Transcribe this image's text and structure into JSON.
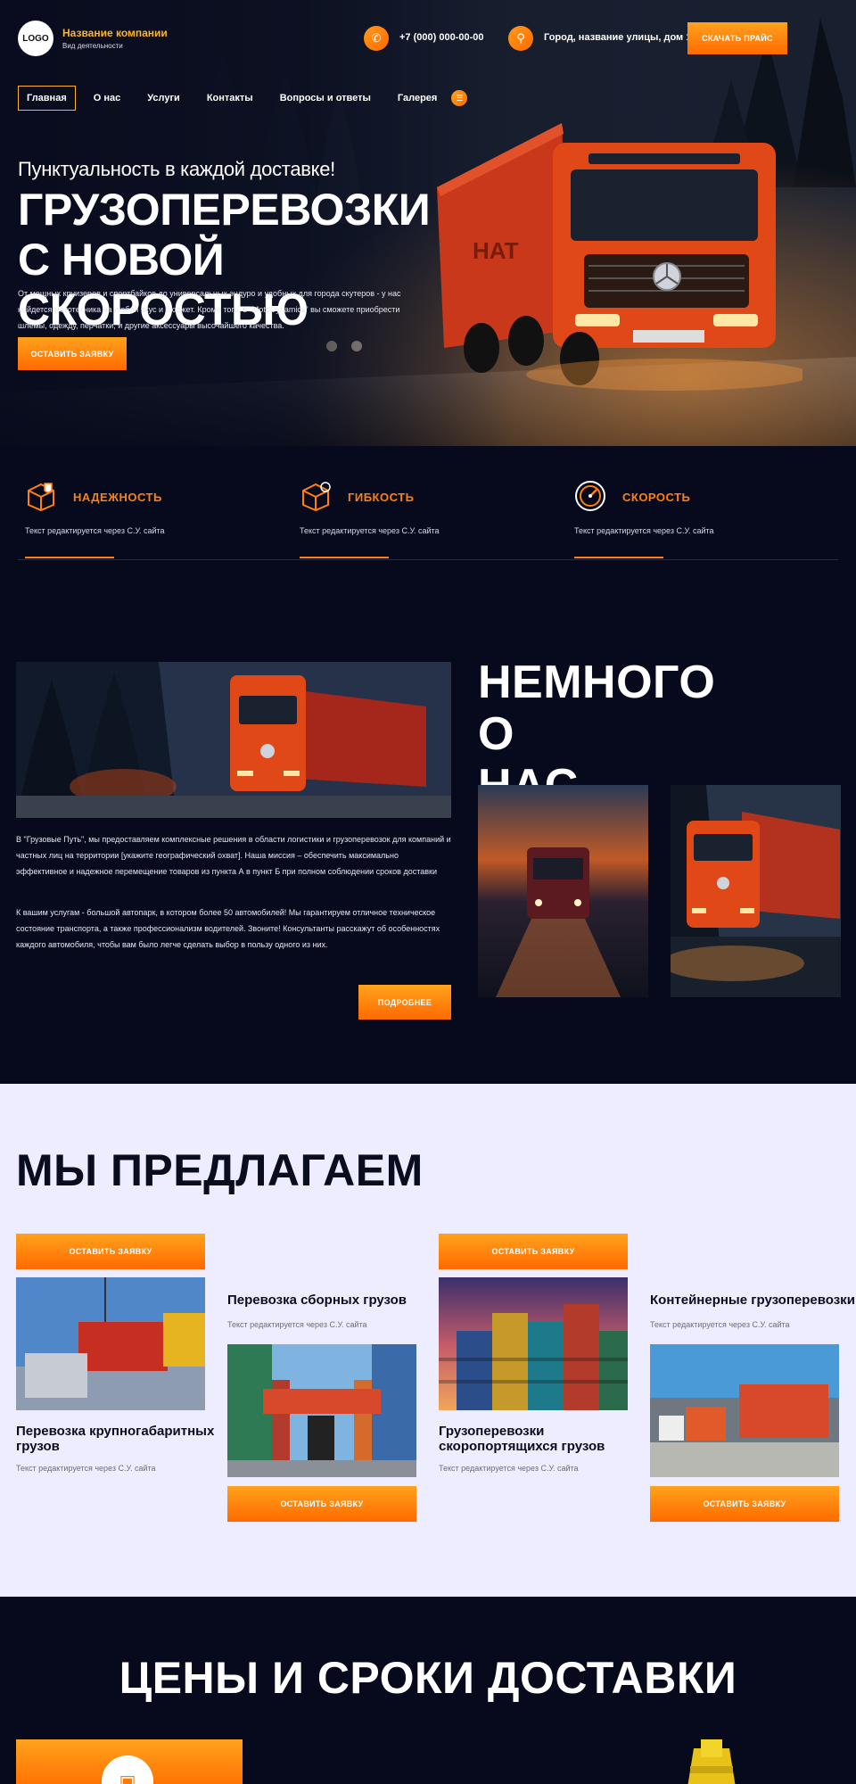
{
  "header": {
    "logo": "LOGO",
    "company_name": "Название компании",
    "company_sub": "Вид деятельности",
    "phone": "+7 (000) 000-00-00",
    "address": "Город, название улицы, дом 1",
    "price_button": "СКАЧАТЬ ПРАЙС",
    "phone_icon": "phone-icon",
    "address_icon": "location-icon"
  },
  "nav": {
    "items": [
      "Главная",
      "О нас",
      "Услуги",
      "Контакты",
      "Вопросы и ответы",
      "Галерея"
    ],
    "active": "Главная",
    "more_icon": "menu-icon"
  },
  "hero": {
    "tagline": "Пунктуальность в каждой доставке!",
    "title_line1": "ГРУЗОПЕРЕВОЗКИ",
    "title_line2": "С НОВОЙ СКОРОСТЬЮ",
    "description": "От мощных круизеров и спортбайков до универсальных эндуро и удобных для города скутеров - у нас найдется мототехника на любой вкус и бюджет. Кроме того, в \"MotoDynamics\" вы сможете приобрести шлемы, одежду, перчатки, и другие аксессуары высочайшего качества.",
    "button": "ОСТАВИТЬ ЗАЯВКУ"
  },
  "features": [
    {
      "title": "НАДЕЖНОСТЬ",
      "text": "Текст редактируется через С.У. сайта",
      "icon": "shield-box-icon"
    },
    {
      "title": "ГИБКОСТЬ",
      "text": "Текст редактируется через С.У. сайта",
      "icon": "box-arrows-icon"
    },
    {
      "title": "СКОРОСТЬ",
      "text": "Текст редактируется через С.У. сайта",
      "icon": "speedometer-icon"
    }
  ],
  "about": {
    "title_line1": "НЕМНОГО О",
    "title_line2": "НАС",
    "p1": "В \"Грузовые Путь\", мы предоставляем комплексные решения в области логистики и грузоперевозок для компаний и частных лиц на территории [укажите географический охват]. Наша миссия – обеспечить максимально эффективное и надежное перемещение товаров из пункта А в пункт Б при полном соблюдении сроков доставки",
    "p2": "К вашим услугам - большой автопарк, в котором более 50 автомобилей! Мы гарантируем отличное техническое состояние транспорта, а также профессионализм водителей. Звоните! Консультанты расскажут об особенностях каждого автомобиля, чтобы вам было легче сделать выбор в пользу одного из них.",
    "button": "ПОДРОБНЕЕ"
  },
  "offer": {
    "title": "МЫ ПРЕДЛАГАЕМ",
    "cards": [
      {
        "title": "Перевозка крупногабаритных грузов",
        "text": "Текст редактируется через С.У. сайта",
        "button": "ОСТАВИТЬ ЗАЯВКУ"
      },
      {
        "title": "Перевозка сборных грузов",
        "text": "Текст редактируется через С.У. сайта",
        "button": "ОСТАВИТЬ ЗАЯВКУ"
      },
      {
        "title": "Грузоперевозки скоропортящихся грузов",
        "text": "Текст редактируется через С.У. сайта",
        "button": "ОСТАВИТЬ ЗАЯВКУ"
      },
      {
        "title": "Контейнерные грузоперевозки",
        "text": "Текст редактируется через С.У. сайта",
        "button": "ОСТАВИТЬ ЗАЯВКУ"
      }
    ]
  },
  "prices": {
    "title": "ЦЕНЫ И СРОКИ ДОСТАВКИ",
    "card_icon": "box-icon"
  },
  "colors": {
    "accent": "#ff7f11",
    "accent_gradient_top": "#ffa21c",
    "accent_gradient_bottom": "#ff6a00",
    "dark_bg": "#070a1c",
    "light_bg": "#eeecff",
    "company_name": "#ffb42b"
  }
}
